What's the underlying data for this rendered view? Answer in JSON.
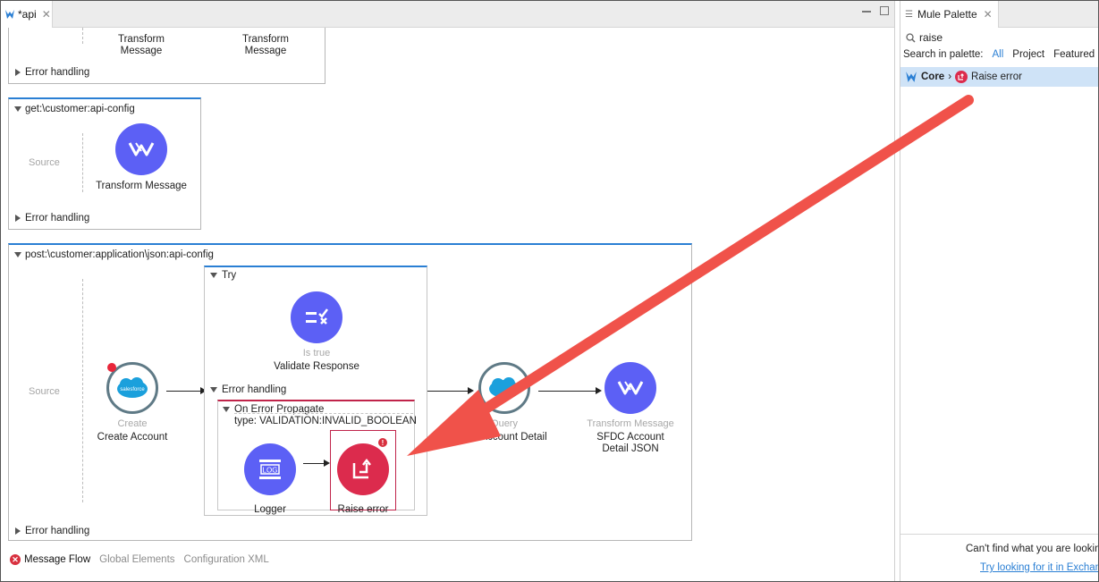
{
  "editor": {
    "tab_title": "*api",
    "flows": [
      {
        "nodes": [
          {
            "name": "Transform Message"
          },
          {
            "name": "Transform Message"
          }
        ],
        "error_handling": "Error handling"
      },
      {
        "title": "get:\\customer:api-config",
        "source": "Source",
        "node_name": "Transform Message",
        "error_handling": "Error handling"
      },
      {
        "title": "post:\\customer:application\\json:api-config",
        "source": "Source",
        "create": {
          "sub": "Create",
          "name": "Create Account",
          "icon_text": "salesforce"
        },
        "try": {
          "label": "Try",
          "validate": {
            "sub": "Is true",
            "name": "Validate Response"
          },
          "error_handling": "Error handling",
          "on_error": {
            "title": "On Error Propagate",
            "type": "type: VALIDATION:INVALID_BOOLEAN",
            "logger": {
              "name": "Logger",
              "icon_text": "LOG"
            },
            "raise": {
              "name": "Raise error"
            }
          }
        },
        "query": {
          "sub": "Query",
          "name": "Get Account Detail"
        },
        "transform": {
          "sub": "Transform Message",
          "name": "SFDC Account",
          "name2": "Detail JSON"
        },
        "error_handling": "Error handling"
      }
    ],
    "bottom_tabs": [
      "Message Flow",
      "Global Elements",
      "Configuration XML"
    ]
  },
  "palette": {
    "tab_title": "Mule Palette",
    "search_value": "raise",
    "search_in": "Search in palette:",
    "filters": [
      "All",
      "Project",
      "Featured"
    ],
    "result": {
      "module": "Core",
      "separator": "›",
      "item": "Raise error"
    },
    "footer_text": "Can't find what you are looking",
    "footer_link": "Try looking for it in Exchange"
  },
  "colors": {
    "mule_purple": "#5c60f5",
    "raise_red": "#dc2b4d",
    "annotation_arrow": "#f0524a",
    "selection_blue": "#cfe3f7"
  }
}
